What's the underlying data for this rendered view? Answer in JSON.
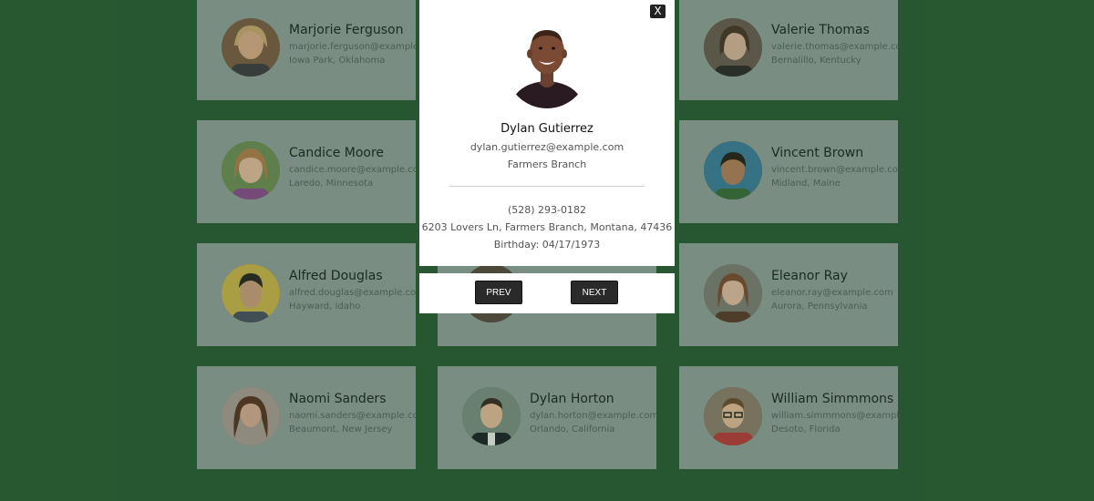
{
  "employees": [
    {
      "name": "Marjorie Ferguson",
      "email": "marjorie.ferguson@example.com",
      "location": "Iowa Park, Oklahoma"
    },
    {
      "name": "Valerie Thomas",
      "email": "valerie.thomas@example.com",
      "location": "Bernalillo, Kentucky"
    },
    {
      "name": "Candice Moore",
      "email": "candice.moore@example.com",
      "location": "Laredo, Minnesota"
    },
    {
      "name": "Vincent Brown",
      "email": "vincent.brown@example.com",
      "location": "Midland, Maine"
    },
    {
      "name": "Alfred Douglas",
      "email": "alfred.douglas@example.com",
      "location": "Hayward, Idaho"
    },
    {
      "name": "Eleanor Ray",
      "email": "eleanor.ray@example.com",
      "location": "Aurora, Pennsylvania"
    },
    {
      "name": "Naomi Sanders",
      "email": "naomi.sanders@example.com",
      "location": "Beaumont, New Jersey"
    },
    {
      "name": "Dylan Horton",
      "email": "dylan.horton@example.com",
      "location": "Orlando, California"
    },
    {
      "name": "William Simmmons",
      "email": "william.simmmons@example.com",
      "location": "Desoto, Florida"
    }
  ],
  "modal": {
    "close_label": "X",
    "name": "Dylan Gutierrez",
    "email": "dylan.gutierrez@example.com",
    "city": "Farmers Branch",
    "phone": "(528) 293-0182",
    "address": "6203 Lovers Ln, Farmers Branch, Montana, 47436",
    "birthday": "Birthday: 04/17/1973"
  },
  "nav": {
    "prev_label": "PREV",
    "next_label": "NEXT"
  },
  "colors": {
    "page_background": "#2a5a32",
    "card_background": "#8e9c96",
    "modal_background": "#ffffff",
    "button_background": "#2a2a2a"
  }
}
